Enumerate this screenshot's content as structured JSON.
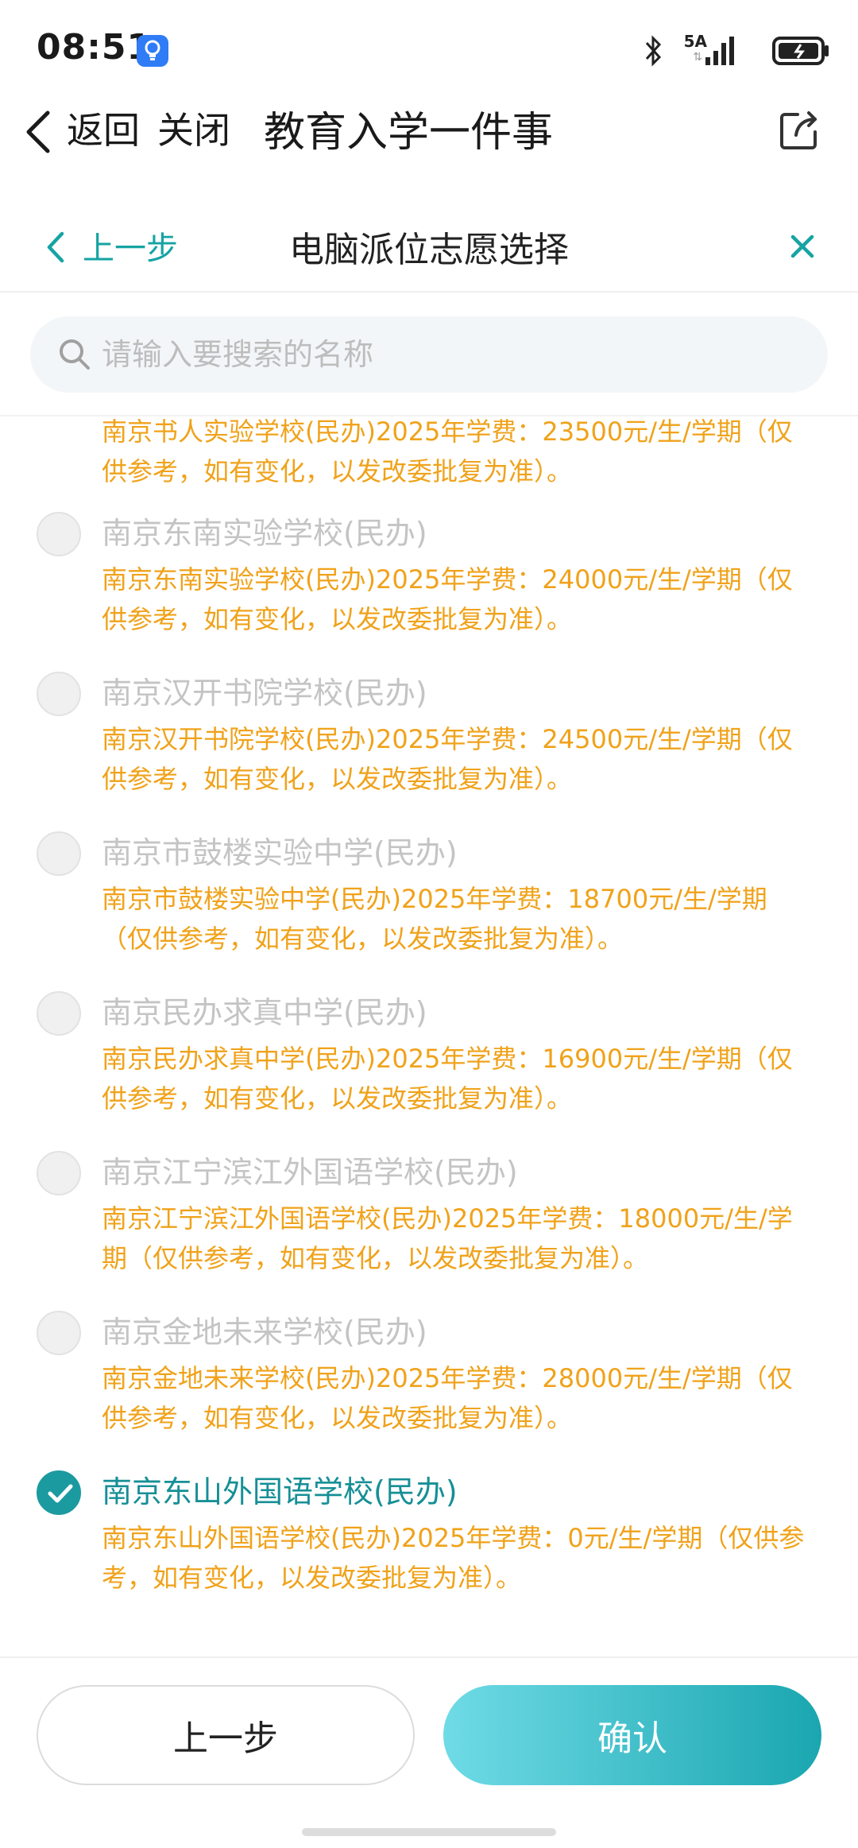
{
  "status_bar": {
    "time": "08:51",
    "network_label": "5A",
    "icons": [
      "lightbulb-app-icon",
      "bluetooth-icon",
      "signal-icon",
      "battery-icon"
    ]
  },
  "header": {
    "back_label": "返回",
    "close_label": "关闭",
    "title": "教育入学一件事"
  },
  "sub_header": {
    "back_label": "上一步",
    "title": "电脑派位志愿选择"
  },
  "search": {
    "placeholder": "请输入要搜索的名称"
  },
  "partial_item_desc": "南京书人实验学校(民办)2025年学费：23500元/生/学期（仅供参考，如有变化，以发改委批复为准）。",
  "items": [
    {
      "name": "南京东南实验学校(民办)",
      "desc": "南京东南实验学校(民办)2025年学费：24000元/生/学期（仅供参考，如有变化，以发改委批复为准）。",
      "checked": false
    },
    {
      "name": "南京汉开书院学校(民办)",
      "desc": "南京汉开书院学校(民办)2025年学费：24500元/生/学期（仅供参考，如有变化，以发改委批复为准）。",
      "checked": false
    },
    {
      "name": "南京市鼓楼实验中学(民办)",
      "desc": "南京市鼓楼实验中学(民办)2025年学费：18700元/生/学期（仅供参考，如有变化，以发改委批复为准）。",
      "checked": false
    },
    {
      "name": "南京民办求真中学(民办)",
      "desc": "南京民办求真中学(民办)2025年学费：16900元/生/学期（仅供参考，如有变化，以发改委批复为准）。",
      "checked": false
    },
    {
      "name": "南京江宁滨江外国语学校(民办)",
      "desc": "南京江宁滨江外国语学校(民办)2025年学费：18000元/生/学期（仅供参考，如有变化，以发改委批复为准）。",
      "checked": false
    },
    {
      "name": "南京金地未来学校(民办)",
      "desc": "南京金地未来学校(民办)2025年学费：28000元/生/学期（仅供参考，如有变化，以发改委批复为准）。",
      "checked": false
    },
    {
      "name": "南京东山外国语学校(民办)",
      "desc": "南京东山外国语学校(民办)2025年学费：0元/生/学期（仅供参考，如有变化，以发改委批复为准）。",
      "checked": true
    }
  ],
  "footer": {
    "prev_label": "上一步",
    "confirm_label": "确认"
  },
  "colors": {
    "accent": "#1b9aa0",
    "fee_text": "#f0a21a",
    "disabled_text": "#c4c4c4"
  }
}
